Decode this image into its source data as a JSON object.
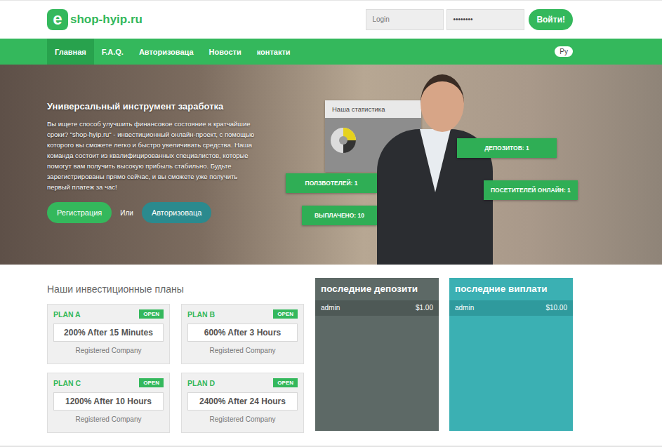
{
  "logo": {
    "mark": "e",
    "text": "shop-hyip.ru"
  },
  "login_form": {
    "login_placeholder": "Login",
    "password_value": "••••••••",
    "button": "Войти!"
  },
  "nav": [
    {
      "label": "Главная",
      "selected": true
    },
    {
      "label": "F.A.Q.",
      "selected": false
    },
    {
      "label": "Авторизоваца",
      "selected": false
    },
    {
      "label": "Новости",
      "selected": false
    },
    {
      "label": "контакти",
      "selected": false
    }
  ],
  "language": "Ру",
  "hero": {
    "title": "Универсальный инструмент заработка",
    "text": "Вы ищете способ улучшить финансовое состояние в кратчайшие сроки? \"shop-hyip.ru\" - инвестиционный онлайн-проект, с помощью которого вы сможете легко и быстро увеличивать средства. Наша команда состоит из квалифицированных специалистов, которые помогут вам получить высокую прибыль стабильно. Будьте зарегистрированы прямо сейчас, и вы сможете уже получить первый платеж за час!",
    "register": "Регистрация",
    "or": "Или",
    "login": "Авторизоваца"
  },
  "stats": {
    "title": "Наша статистика",
    "badges": [
      "ДЕПОЗИТОВ: 1",
      "ПОЛЗВОТЕЛЕЙ: 1",
      "ПОСЕТИТЕЛЕЙ ОНЛАЙН: 1",
      "ВЫПЛАЧЕНО: 10"
    ]
  },
  "plans": {
    "title": "Наши инвестиционные планы",
    "items": [
      {
        "name": "PLAN A",
        "status": "OPEN",
        "offer": "200% After 15 Minutes",
        "note": "Registered Company"
      },
      {
        "name": "PLAN B",
        "status": "OPEN",
        "offer": "600% After 3 Hours",
        "note": "Registered Company"
      },
      {
        "name": "PLAN C",
        "status": "OPEN",
        "offer": "1200% After 10 Hours",
        "note": "Registered Company"
      },
      {
        "name": "PLAN D",
        "status": "OPEN",
        "offer": "2400% After 24 Hours",
        "note": "Registered Company"
      }
    ]
  },
  "deposits": {
    "title": "последние депозити",
    "rows": [
      {
        "user": "admin",
        "amount": "$1.00"
      }
    ]
  },
  "payouts": {
    "title": "последние виплати",
    "rows": [
      {
        "user": "admin",
        "amount": "$10.00"
      }
    ]
  }
}
